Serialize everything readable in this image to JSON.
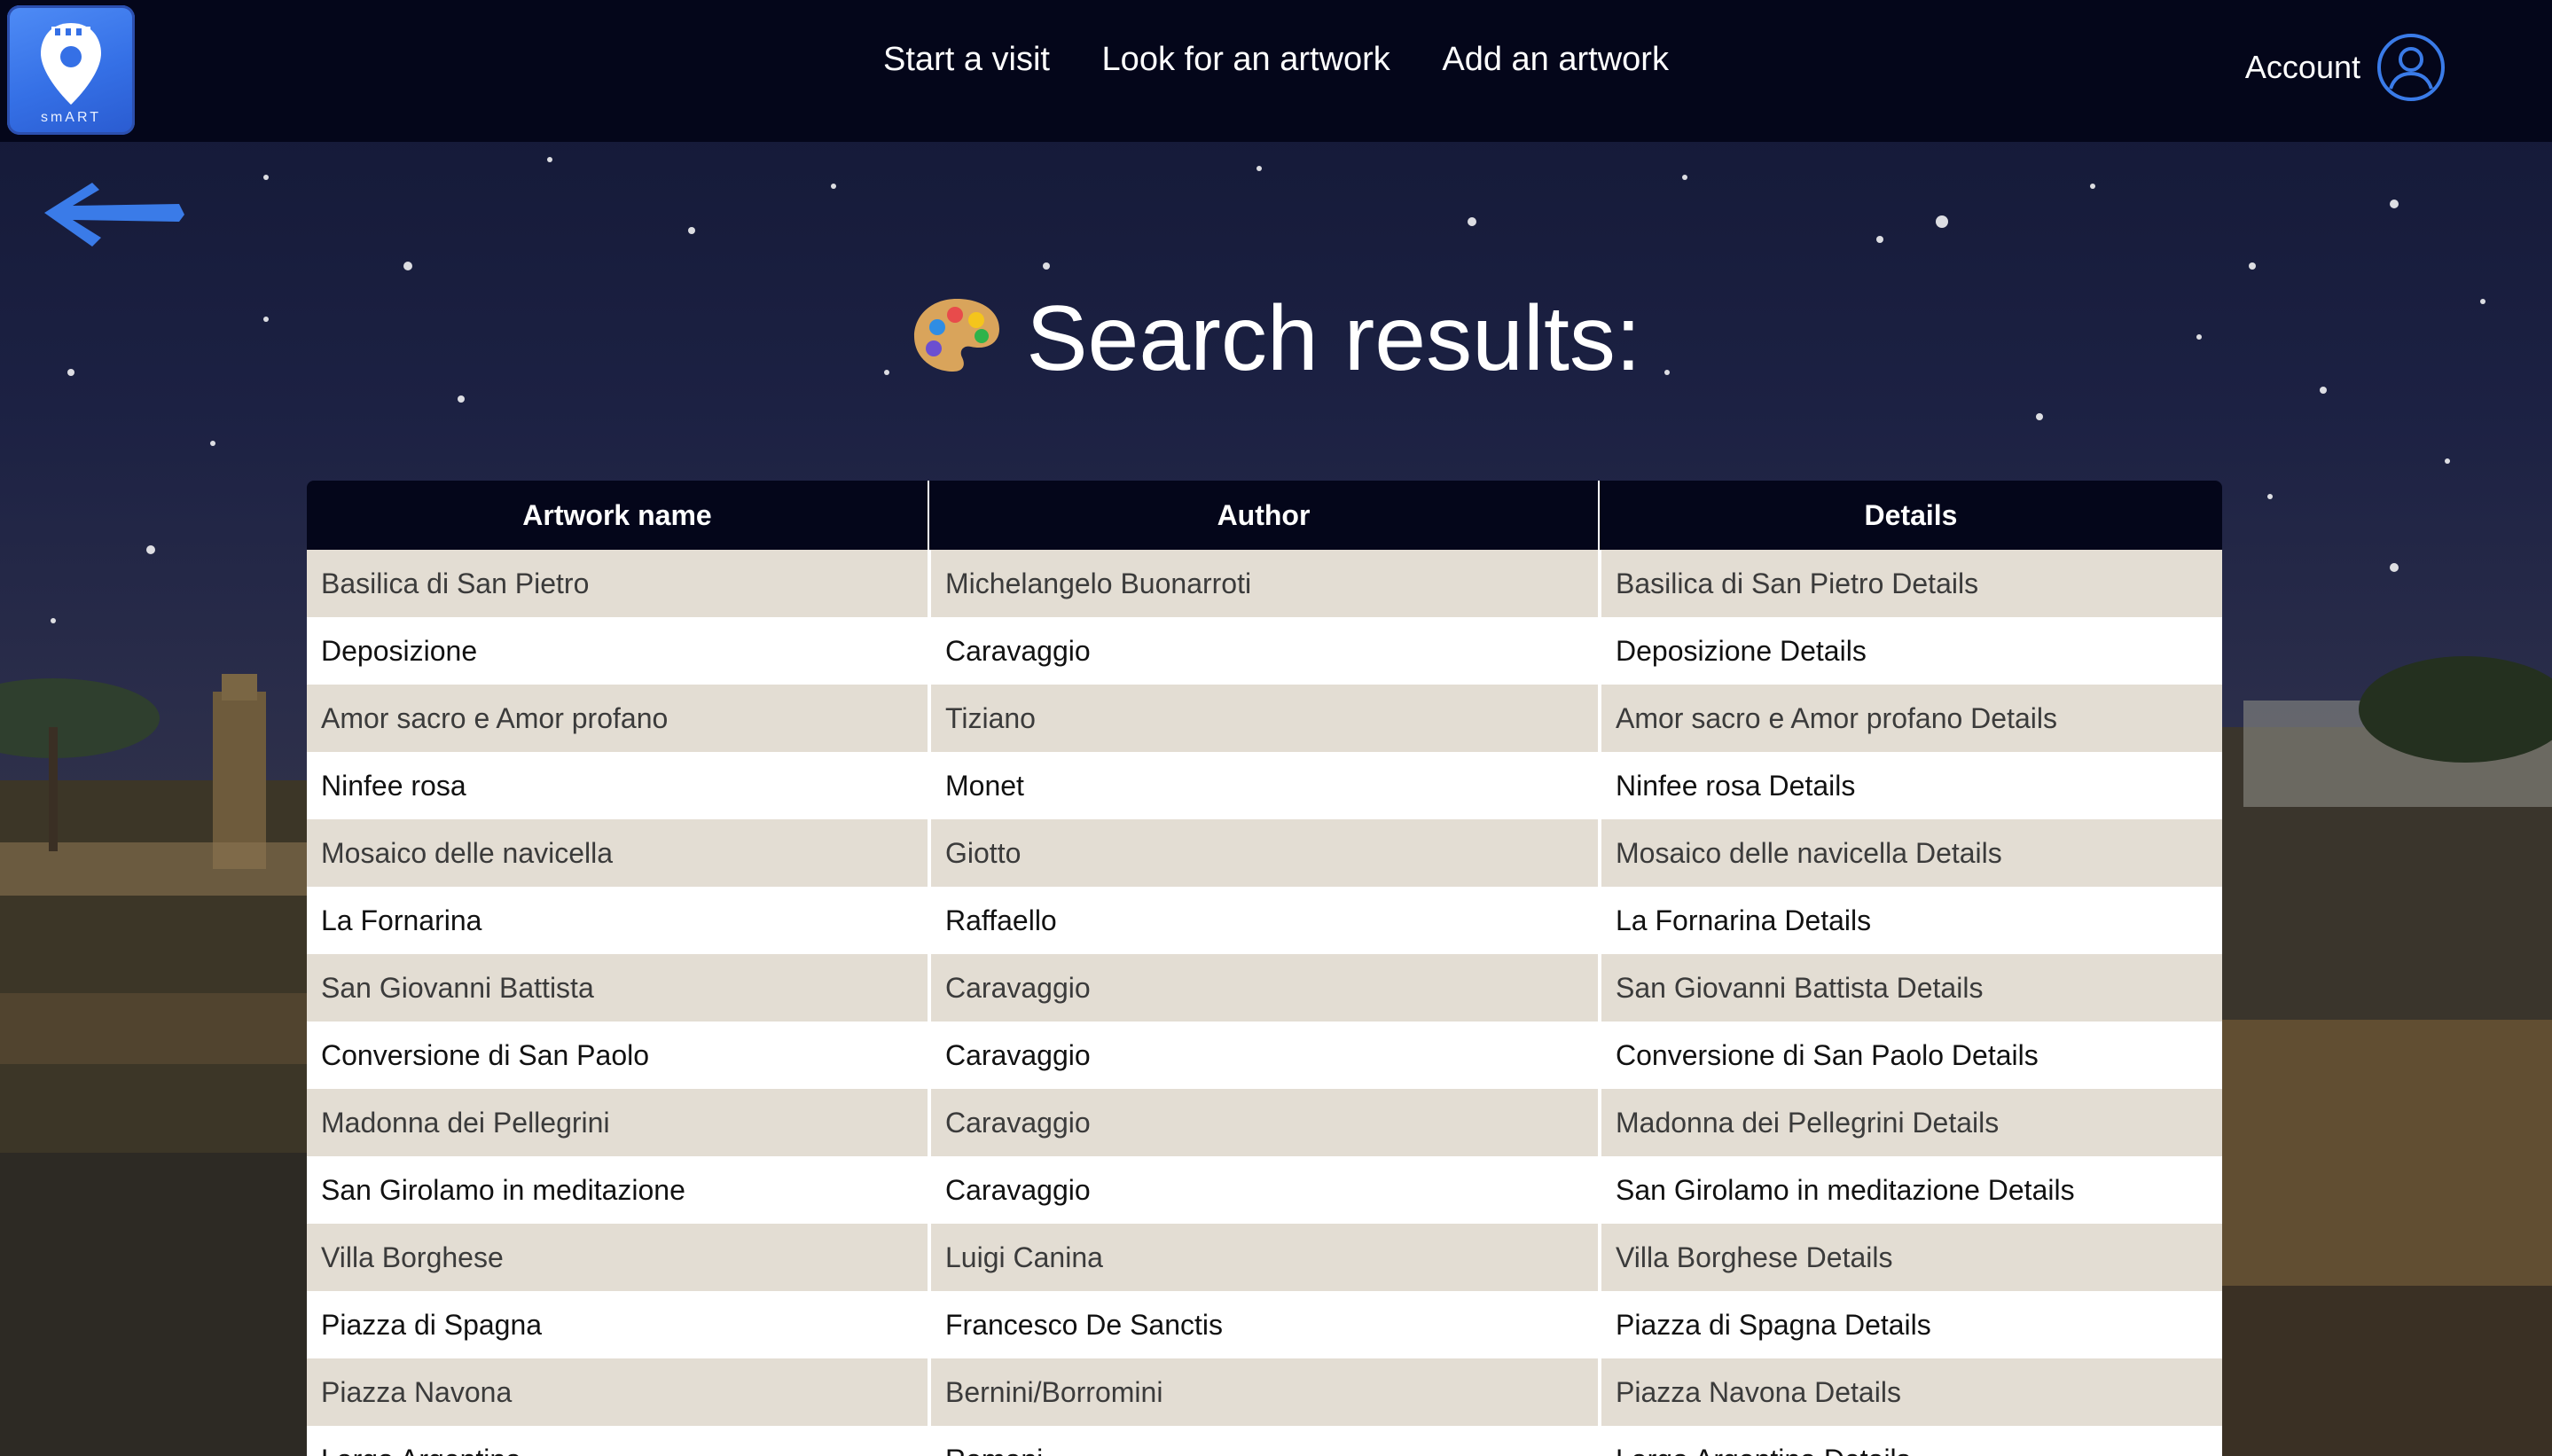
{
  "header": {
    "logo_text": "smART",
    "nav": [
      {
        "label": "Start a visit"
      },
      {
        "label": "Look for an artwork"
      },
      {
        "label": "Add an artwork"
      }
    ],
    "account_label": "Account"
  },
  "page": {
    "title": "Search results:",
    "title_icon": "artist-palette-icon",
    "back_icon": "back-arrow-icon"
  },
  "table": {
    "columns": [
      "Artwork name",
      "Author",
      "Details"
    ],
    "rows": [
      [
        "Basilica di San Pietro",
        "Michelangelo Buonarroti",
        "Basilica di San Pietro Details"
      ],
      [
        "Deposizione",
        "Caravaggio",
        "Deposizione Details"
      ],
      [
        "Amor sacro e Amor profano",
        "Tiziano",
        "Amor sacro e Amor profano Details"
      ],
      [
        "Ninfee rosa",
        "Monet",
        "Ninfee rosa Details"
      ],
      [
        "Mosaico delle navicella",
        "Giotto",
        "Mosaico delle navicella Details"
      ],
      [
        "La Fornarina",
        "Raffaello",
        "La Fornarina Details"
      ],
      [
        "San Giovanni Battista",
        "Caravaggio",
        "San Giovanni Battista Details"
      ],
      [
        "Conversione di San Paolo",
        "Caravaggio",
        "Conversione di San Paolo Details"
      ],
      [
        "Madonna dei Pellegrini",
        "Caravaggio",
        "Madonna dei Pellegrini Details"
      ],
      [
        "San Girolamo in meditazione",
        "Caravaggio",
        "San Girolamo in meditazione Details"
      ],
      [
        "Villa Borghese",
        "Luigi Canina",
        "Villa Borghese Details"
      ],
      [
        "Piazza di Spagna",
        "Francesco De Sanctis",
        "Piazza di Spagna Details"
      ],
      [
        "Piazza Navona",
        "Bernini/Borromini",
        "Piazza Navona Details"
      ],
      [
        "Largo Argentina",
        "Romani",
        "Largo Argentina Details"
      ]
    ]
  },
  "colors": {
    "header_bg": "#04061a",
    "row_odd": "#e3ddd3",
    "row_even": "#ffffff",
    "accent": "#3a7be8"
  }
}
